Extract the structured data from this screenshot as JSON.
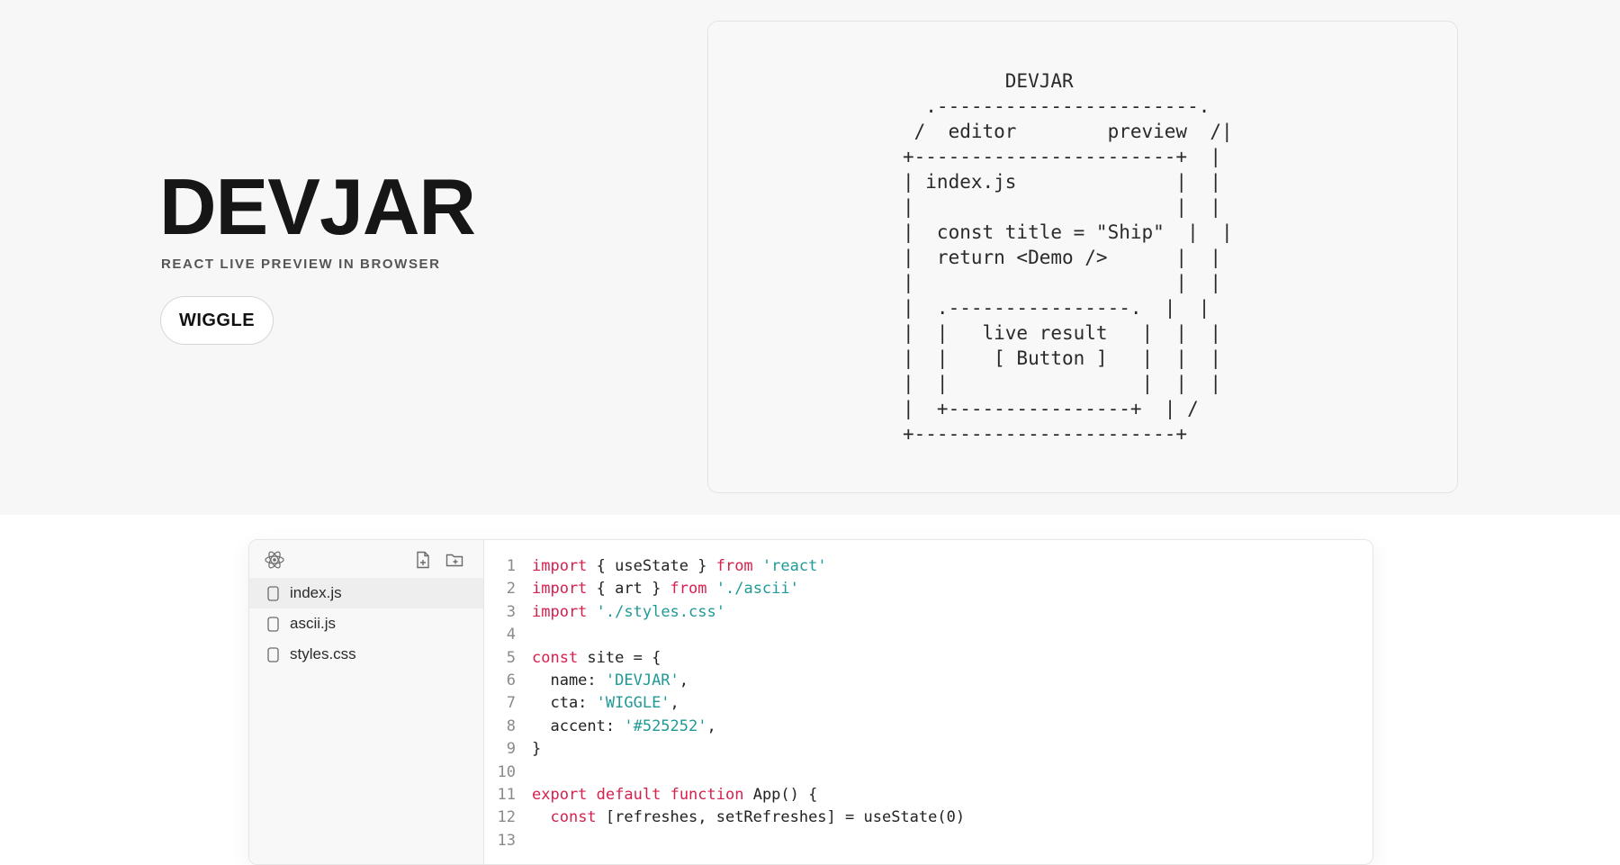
{
  "brand": {
    "title": "DEVJAR",
    "subtitle": "REACT LIVE PREVIEW IN BROWSER",
    "cta_label": "WIGGLE"
  },
  "ascii_art": "         DEVJAR\n  .-----------------------.\n /  editor        preview  /|\n+-----------------------+  |\n| index.js              |  |\n|                       |  |\n|  const title = \"Ship\"  |  |\n|  return <Demo />      |  |\n|                       |  |\n|  .----------------.  |  |\n|  |   live result   |  |  |\n|  |    [ Button ]   |  |  |\n|  |                 |  |  |\n|  +----------------+  | /\n+-----------------------+",
  "explorer": {
    "icons": {
      "logo": "react-icon",
      "new_file": "new-file-icon",
      "new_folder": "new-folder-icon"
    },
    "files": [
      {
        "name": "index.js",
        "active": true
      },
      {
        "name": "ascii.js",
        "active": false
      },
      {
        "name": "styles.css",
        "active": false
      }
    ]
  },
  "colors": {
    "keyword": "#d6204e",
    "string": "#1f9a96",
    "text": "#222222",
    "line_number": "#8a8a8a"
  },
  "code_lines": [
    {
      "n": "1",
      "tokens": [
        {
          "t": "import",
          "c": "kw"
        },
        {
          "t": " { useState } ",
          "c": "plain"
        },
        {
          "t": "from",
          "c": "kw"
        },
        {
          "t": " ",
          "c": "plain"
        },
        {
          "t": "'react'",
          "c": "str"
        }
      ]
    },
    {
      "n": "2",
      "tokens": [
        {
          "t": "import",
          "c": "kw"
        },
        {
          "t": " { art } ",
          "c": "plain"
        },
        {
          "t": "from",
          "c": "kw"
        },
        {
          "t": " ",
          "c": "plain"
        },
        {
          "t": "'./ascii'",
          "c": "str"
        }
      ]
    },
    {
      "n": "3",
      "tokens": [
        {
          "t": "import",
          "c": "kw"
        },
        {
          "t": " ",
          "c": "plain"
        },
        {
          "t": "'./styles.css'",
          "c": "str"
        }
      ]
    },
    {
      "n": "4",
      "tokens": []
    },
    {
      "n": "5",
      "tokens": [
        {
          "t": "const",
          "c": "kw"
        },
        {
          "t": " site = {",
          "c": "plain"
        }
      ]
    },
    {
      "n": "6",
      "tokens": [
        {
          "t": "  name: ",
          "c": "plain"
        },
        {
          "t": "'DEVJAR'",
          "c": "str"
        },
        {
          "t": ",",
          "c": "plain"
        }
      ]
    },
    {
      "n": "7",
      "tokens": [
        {
          "t": "  cta: ",
          "c": "plain"
        },
        {
          "t": "'WIGGLE'",
          "c": "str"
        },
        {
          "t": ",",
          "c": "plain"
        }
      ]
    },
    {
      "n": "8",
      "tokens": [
        {
          "t": "  accent: ",
          "c": "plain"
        },
        {
          "t": "'#525252'",
          "c": "str"
        },
        {
          "t": ",",
          "c": "plain"
        }
      ]
    },
    {
      "n": "9",
      "tokens": [
        {
          "t": "}",
          "c": "plain"
        }
      ]
    },
    {
      "n": "10",
      "tokens": []
    },
    {
      "n": "11",
      "tokens": [
        {
          "t": "export",
          "c": "kw"
        },
        {
          "t": " ",
          "c": "plain"
        },
        {
          "t": "default",
          "c": "kw"
        },
        {
          "t": " ",
          "c": "plain"
        },
        {
          "t": "function",
          "c": "kw"
        },
        {
          "t": " App() {",
          "c": "plain"
        }
      ]
    },
    {
      "n": "12",
      "tokens": [
        {
          "t": "  ",
          "c": "plain"
        },
        {
          "t": "const",
          "c": "kw"
        },
        {
          "t": " [refreshes, setRefreshes] = useState(0)",
          "c": "plain"
        }
      ]
    },
    {
      "n": "13",
      "tokens": []
    }
  ]
}
